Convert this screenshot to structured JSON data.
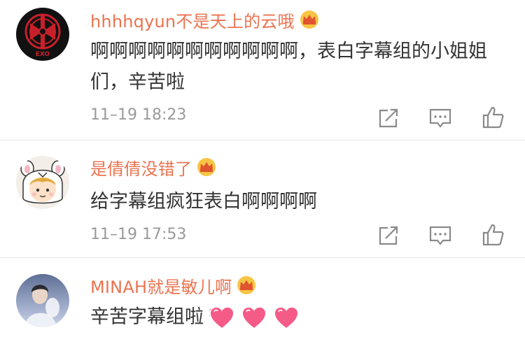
{
  "comments": [
    {
      "username": "hhhhqyun不是天上的云哦",
      "text": "啊啊啊啊啊啊啊啊啊啊啊，表白字幕组的小姐姐们，辛苦啦",
      "time": "11–19 18:23",
      "avatar_label": "EXO"
    },
    {
      "username": "是倩倩没错了",
      "text": "给字幕组疯狂表白啊啊啊啊",
      "time": "11–19 17:53"
    },
    {
      "username": "MINAH就是敏儿啊",
      "text": "辛苦字幕组啦"
    }
  ],
  "icons": {
    "share": "share-icon",
    "comment": "comment-icon",
    "like": "like-icon",
    "crown": "crown-badge-icon",
    "heart": "heart-emoji-icon"
  },
  "colors": {
    "username": "#eb7350",
    "text": "#333333",
    "time": "#9a9a9a",
    "divider": "#e6e6e6"
  }
}
